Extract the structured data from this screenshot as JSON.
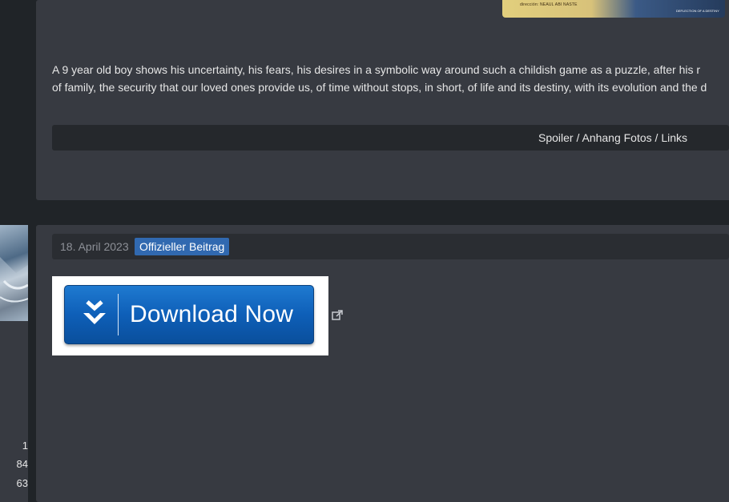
{
  "poster": {
    "credit_text": "dirección: NEAUL ABI NASTE",
    "subtitle_text": "DEFLECTION OF A DESTINY"
  },
  "post1": {
    "description_line1": "A 9 year old boy shows his uncertainty, his fears, his desires in a symbolic way around such a childish game as a puzzle, after his r",
    "description_line2": "of family, the security that our loved ones provide us, of time without stops, in short, of life and its destiny, with its evolution and the d",
    "spoiler_label": "Spoiler / Anhang Fotos / Links"
  },
  "post2": {
    "date": "18. April 2023",
    "badge": "Offizieller Beitrag",
    "download_label": "Download Now"
  },
  "user_stats": [
    "1",
    "84",
    "63"
  ],
  "colors": {
    "page_bg": "#202428",
    "panel_bg": "#373a41",
    "badge_bg": "#3169b0",
    "button_blue": "#0e5fb8"
  },
  "icons": {
    "download": "double-chevron-down-icon",
    "external_link": "external-link-icon"
  }
}
